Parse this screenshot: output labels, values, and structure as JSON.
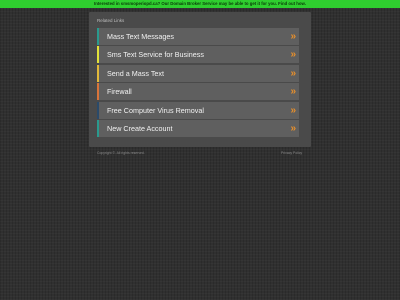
{
  "banner": {
    "text": "Interested in smsmoperiopd.ca? Our Domain Broker Service may be able to get it for you. Find out how.",
    "color": "#2fce2f"
  },
  "panel": {
    "title": "Related Links"
  },
  "links": [
    {
      "label": "Mass Text Messages",
      "accent": "#2a9a8e",
      "arrow": "»"
    },
    {
      "label": "Sms Text Service for Business",
      "accent": "#e2e23a",
      "arrow": "»"
    },
    {
      "label": "Send a Mass Text",
      "accent": "#e2b93a",
      "arrow": "»"
    },
    {
      "label": "Firewall",
      "accent": "#d9743a",
      "arrow": "»"
    },
    {
      "label": "Free Computer Virus Removal",
      "accent": "#2a4a6a",
      "arrow": "»"
    },
    {
      "label": "New Create Account",
      "accent": "#2a9a8e",
      "arrow": "»"
    }
  ],
  "footer": {
    "copyright": "Copyright ©. All rights reserved.",
    "privacy": "Privacy Policy"
  },
  "colors": {
    "background": "#303030",
    "panel": "#4a4a4a",
    "link_bg": "#5f5f5f",
    "arrow": "#e8902c"
  }
}
